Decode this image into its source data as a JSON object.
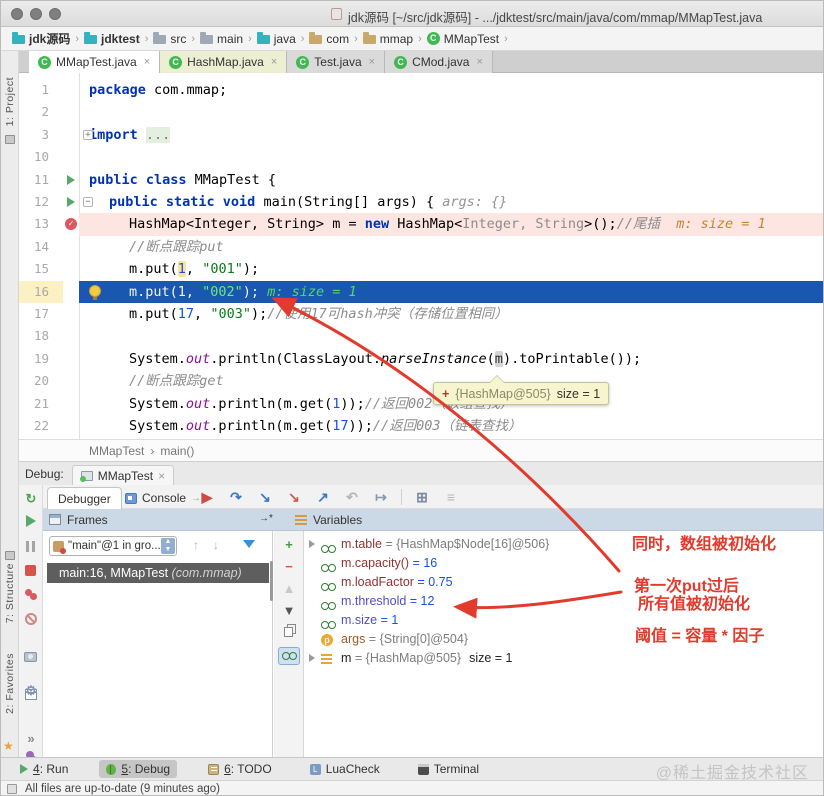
{
  "titlebar": {
    "title": "jdk源码 [~/src/jdk源码] - .../jdktest/src/main/java/com/mmap/MMapTest.java"
  },
  "navbar": {
    "items": [
      {
        "label": "jdk源码",
        "icon": "folder",
        "color": "#33b3bd",
        "bold": true
      },
      {
        "label": "jdktest",
        "icon": "folder",
        "color": "#33b3bd",
        "bold": true
      },
      {
        "label": "src",
        "icon": "folder",
        "color": "#9fa9b3"
      },
      {
        "label": "main",
        "icon": "folder",
        "color": "#9fa9b3"
      },
      {
        "label": "java",
        "icon": "folder",
        "color": "#33b3bd"
      },
      {
        "label": "com",
        "icon": "folder",
        "color": "#c9a86b"
      },
      {
        "label": "mmap",
        "icon": "folder",
        "color": "#c9a86b"
      },
      {
        "label": "MMapTest",
        "icon": "class",
        "color": "#3fba50"
      }
    ]
  },
  "tabs": [
    {
      "label": "MMapTest.java",
      "state": "active"
    },
    {
      "label": "HashMap.java",
      "state": "tint"
    },
    {
      "label": "Test.java",
      "state": ""
    },
    {
      "label": "CMod.java",
      "state": ""
    }
  ],
  "side_labels": {
    "project": "1: Project",
    "structure": "7: Structure",
    "favorites": "2: Favorites"
  },
  "editor": {
    "lines": [
      {
        "num": "1",
        "indent": 0,
        "segs": [
          [
            "kw",
            "package"
          ],
          [
            "pl",
            " com.mmap;"
          ]
        ]
      },
      {
        "num": "2",
        "indent": 0,
        "segs": []
      },
      {
        "num": "3",
        "indent": 0,
        "fold": "+",
        "segs": [
          [
            "kw",
            "import"
          ],
          [
            "pl",
            " "
          ],
          [
            "fold3",
            "..."
          ]
        ]
      },
      {
        "num": "10",
        "indent": 0,
        "segs": []
      },
      {
        "num": "11",
        "indent": 0,
        "gutter": "run",
        "segs": [
          [
            "kw",
            "public class"
          ],
          [
            "pl",
            " MMapTest {"
          ]
        ]
      },
      {
        "num": "12",
        "indent": 1,
        "gutter": "run",
        "fold": "-",
        "segs": [
          [
            "kw",
            "public static void"
          ],
          [
            "pl",
            " main(String[] args) { "
          ],
          [
            "hintgray",
            "args: {}"
          ]
        ]
      },
      {
        "num": "13",
        "indent": 2,
        "gutter": "bp",
        "bg": "pink",
        "segs": [
          [
            "pl",
            "HashMap<Integer, String> m = "
          ],
          [
            "kw",
            "new"
          ],
          [
            "pl",
            " HashMap<"
          ],
          [
            "gray",
            "Integer, String"
          ],
          [
            "pl",
            ">();"
          ],
          [
            "cmt",
            "//尾插"
          ],
          [
            "pl",
            "  "
          ],
          [
            "hintorange",
            "m: size = 1"
          ]
        ]
      },
      {
        "num": "14",
        "indent": 2,
        "segs": [
          [
            "cmt",
            "//断点跟踪put"
          ]
        ]
      },
      {
        "num": "15",
        "indent": 2,
        "segs": [
          [
            "pl",
            "m.put("
          ],
          [
            "numhl",
            "1"
          ],
          [
            "pl",
            ", "
          ],
          [
            "str",
            "\"001\""
          ],
          [
            "pl",
            ");"
          ]
        ]
      },
      {
        "num": "16",
        "indent": 2,
        "gutter": "bulb",
        "bg": "blue",
        "numbg": true,
        "segs": [
          [
            "wh",
            "m.put(1, "
          ],
          [
            "strw",
            "\"002\""
          ],
          [
            "wh",
            "); "
          ],
          [
            "hintgreen",
            "m: size = 1"
          ]
        ]
      },
      {
        "num": "17",
        "indent": 2,
        "segs": [
          [
            "pl",
            "m.put("
          ],
          [
            "num",
            "17"
          ],
          [
            "pl",
            ", "
          ],
          [
            "str",
            "\"003\""
          ],
          [
            "pl",
            ");"
          ],
          [
            "cmt",
            "//使用17可hash冲突（存储位置相同）"
          ]
        ]
      },
      {
        "num": "18",
        "indent": 2,
        "segs": []
      },
      {
        "num": "19",
        "indent": 2,
        "segs": [
          [
            "pl",
            "System."
          ],
          [
            "field",
            "out"
          ],
          [
            "pl",
            ".println(ClassLayout."
          ],
          [
            "it",
            "parseInstance"
          ],
          [
            "pl",
            "("
          ],
          [
            "mhl",
            "m"
          ],
          [
            "pl",
            ").toPrintable());"
          ]
        ]
      },
      {
        "num": "20",
        "indent": 2,
        "segs": [
          [
            "cmt",
            "//断点跟踪get"
          ]
        ]
      },
      {
        "num": "21",
        "indent": 2,
        "segs": [
          [
            "pl",
            "System."
          ],
          [
            "field",
            "out"
          ],
          [
            "pl",
            ".println(m.get("
          ],
          [
            "num",
            "1"
          ],
          [
            "pl",
            "));"
          ],
          [
            "cmt",
            "//返回002（数组查找）"
          ]
        ]
      },
      {
        "num": "22",
        "indent": 2,
        "segs": [
          [
            "pl",
            "System."
          ],
          [
            "field",
            "out"
          ],
          [
            "pl",
            ".println(m.get("
          ],
          [
            "num",
            "17"
          ],
          [
            "pl",
            "));"
          ],
          [
            "cmt",
            "//返回003（链表查找）"
          ]
        ]
      }
    ],
    "breadcrumb": {
      "class": "MMapTest",
      "method": "main()"
    },
    "tooltip": {
      "plus": "+",
      "ref": "{HashMap@505}",
      "value": "size = 1"
    }
  },
  "debug": {
    "label": "Debug:",
    "session_tab": "MMapTest",
    "tabs": [
      {
        "label": "Debugger",
        "active": true
      },
      {
        "label": "Console",
        "active": false
      }
    ],
    "pin_hint": "→*",
    "left_toolbar": [
      "rerun-icon",
      "resume-icon",
      "pause-icon",
      "stop-icon",
      "view-breakpoints-icon",
      "mute-breakpoints-icon",
      "thread-dump-icon",
      "restore-layout-icon",
      "settings-icon",
      "pin-icon",
      "more-icon"
    ],
    "step_toolbar": [
      "show-execution-point-icon",
      "step-over-icon",
      "step-into-icon",
      "force-step-into-icon",
      "step-out-icon",
      "drop-frame-icon",
      "run-to-cursor-icon",
      "evaluate-expression-icon",
      "layout-settings-icon"
    ],
    "frames": {
      "header": "Frames",
      "thread": "\"main\"@1 in gro...",
      "frame": "main:16, MMapTest ",
      "frame_pkg": "(com.mmap)"
    },
    "variables": {
      "header": "Variables",
      "toolbar": [
        "add-watch-icon",
        "remove-watch-icon",
        "move-up-icon",
        "move-down-icon",
        "duplicate-watch-icon",
        "show-watches-icon"
      ],
      "rows": [
        {
          "expand": true,
          "icon": "watch",
          "name": "m.table",
          "name_cls": "red",
          "value": "= {HashMap$Node[16]@506}",
          "value_cls": "ref"
        },
        {
          "expand": false,
          "icon": "watch",
          "name": "m.capacity()",
          "name_cls": "red",
          "value": "= 16",
          "value_cls": "num"
        },
        {
          "expand": false,
          "icon": "watch",
          "name": "m.loadFactor",
          "name_cls": "red",
          "value": "= 0.75",
          "value_cls": "num"
        },
        {
          "expand": false,
          "icon": "watch",
          "name": "m.threshold",
          "name_cls": "blue",
          "value": "= 12",
          "value_cls": "num"
        },
        {
          "expand": false,
          "icon": "watch",
          "name": "m.size",
          "name_cls": "blue",
          "value": "= 1",
          "value_cls": "num"
        },
        {
          "expand": false,
          "icon": "param",
          "name": "args",
          "name_cls": "param",
          "value": "= {String[0]@504}",
          "value_cls": "ref"
        },
        {
          "expand": true,
          "icon": "fields",
          "name": "m",
          "name_cls": "plain",
          "value": "= {HashMap@505}",
          "value_cls": "ref",
          "extra": "size = 1"
        }
      ]
    }
  },
  "annotations": [
    "同时，数组被初始化",
    "第一次put过后",
    "所有值被初始化",
    "阈值 = 容量 * 因子"
  ],
  "annotation_color": "#e23a2c",
  "colors": {
    "execution_line": "#1a57b0",
    "breakpoint_line": "#fde5e1",
    "accent_blue": "#3b78c4"
  },
  "bottombar": {
    "items": [
      {
        "key": "4",
        "label": "Run",
        "icon": "run-icon",
        "active": false
      },
      {
        "key": "5",
        "label": "Debug",
        "icon": "debug-icon",
        "active": true
      },
      {
        "key": "6",
        "label": "TODO",
        "icon": "todo-icon",
        "active": false
      },
      {
        "key": "",
        "label": "LuaCheck",
        "icon": "luacheck-icon",
        "active": false
      },
      {
        "key": "",
        "label": "Terminal",
        "icon": "terminal-icon",
        "active": false
      }
    ],
    "watermark": "@稀土掘金技术社区"
  },
  "statusbar": {
    "text": "All files are up-to-date (9 minutes ago)"
  }
}
